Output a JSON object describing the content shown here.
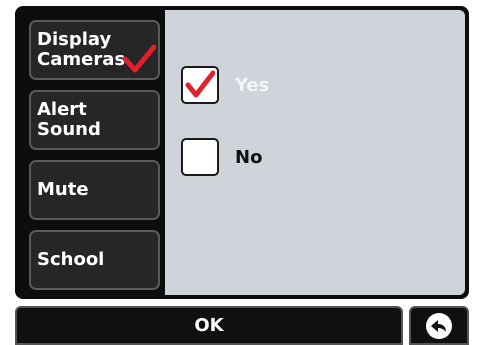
{
  "menu": {
    "items": [
      {
        "label": "Display\nCameras",
        "selected": true
      },
      {
        "label": "Alert\nSound",
        "selected": false
      },
      {
        "label": "Mute",
        "selected": false
      },
      {
        "label": "School",
        "selected": false
      }
    ]
  },
  "options": [
    {
      "label": "Yes",
      "checked": true
    },
    {
      "label": "No",
      "checked": false
    }
  ],
  "footer": {
    "ok_label": "OK",
    "back_icon": "back-arrow-icon"
  },
  "colors": {
    "checkmark": "#e0202a",
    "panel": "#ced4d9",
    "button": "#262626"
  }
}
